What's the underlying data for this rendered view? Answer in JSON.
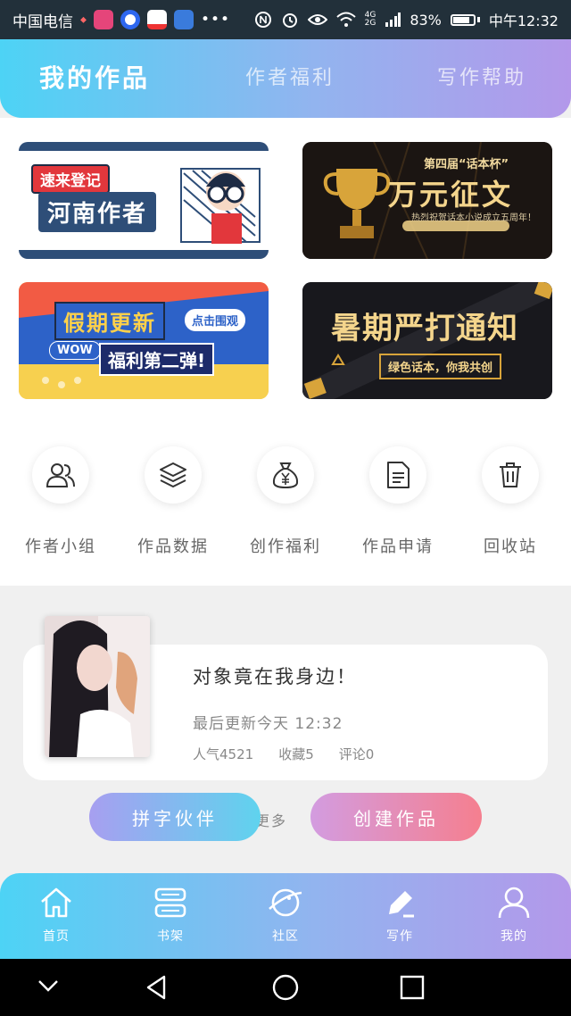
{
  "status_bar": {
    "carrier": "中国电信",
    "network": "4G",
    "network_sub": "2G",
    "battery_percent": "83%",
    "battery_level": 0.83,
    "time": "中午12:32",
    "icons": [
      "weibo-app-icon",
      "baidu-app-icon",
      "taobao-app-icon",
      "cloud-app-icon",
      "more-dots-icon",
      "nfc-icon",
      "alarm-icon",
      "eye-icon",
      "wifi-icon",
      "signal-icon",
      "battery-icon"
    ]
  },
  "top_tabs": [
    {
      "label": "我的作品",
      "active": true
    },
    {
      "label": "作者福利",
      "active": false
    },
    {
      "label": "写作帮助",
      "active": false
    }
  ],
  "banners": [
    {
      "tag": "速来登记",
      "title": "河南作者"
    },
    {
      "tag": "第四届“话本杯”",
      "title": "万元征文",
      "subtitle": "热烈祝贺话本小说成立五周年！"
    },
    {
      "title": "假期更新",
      "tag": "点击围观",
      "badge": "WOW",
      "subtitle": "福利第二弹!"
    },
    {
      "title": "暑期严打通知",
      "subtitle": "绿色话本，你我共创"
    }
  ],
  "quick_actions": [
    {
      "label": "作者小组",
      "icon": "users-icon"
    },
    {
      "label": "作品数据",
      "icon": "layers-icon"
    },
    {
      "label": "创作福利",
      "icon": "money-bag-icon"
    },
    {
      "label": "作品申请",
      "icon": "document-icon"
    },
    {
      "label": "回收站",
      "icon": "trash-icon"
    }
  ],
  "work": {
    "title": "对象竟在我身边！",
    "updated": "最后更新今天 12:32",
    "popularity": "人气4521",
    "favorites": "收藏5",
    "comments": "评论0"
  },
  "more_text": "更多",
  "buttons": {
    "partner": "拼字伙伴",
    "create": "创建作品"
  },
  "bottom_nav": [
    {
      "label": "首页",
      "icon": "home-icon"
    },
    {
      "label": "书架",
      "icon": "bookshelf-icon"
    },
    {
      "label": "社区",
      "icon": "planet-icon"
    },
    {
      "label": "写作",
      "icon": "pen-icon"
    },
    {
      "label": "我的",
      "icon": "person-icon"
    }
  ],
  "colors": {
    "gradient_start": "#4dd3f5",
    "gradient_end": "#b398ea",
    "create_button": "#f57f8f",
    "partner_button": "#5fd3ee"
  }
}
